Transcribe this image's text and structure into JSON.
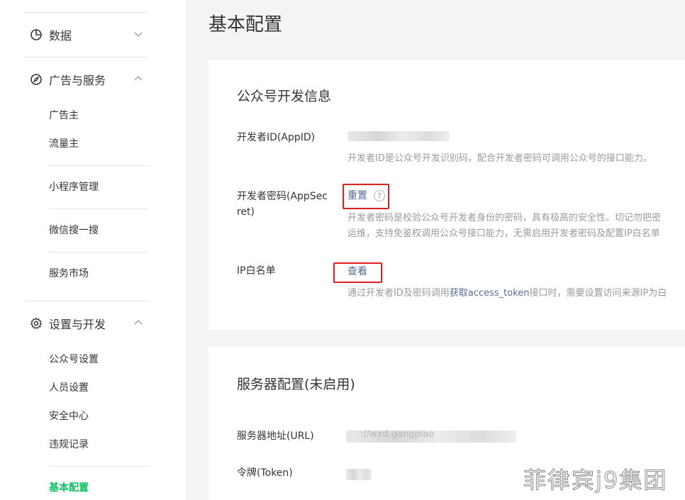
{
  "sidebar": {
    "groups": [
      {
        "label": "数据",
        "icon": "chart-pie-icon",
        "expanded": false
      },
      {
        "label": "广告与服务",
        "icon": "compass-icon",
        "expanded": true,
        "items": [
          "广告主",
          "流量主"
        ]
      },
      {
        "label": "设置与开发",
        "icon": "gear-icon",
        "expanded": true,
        "items": [
          "公众号设置",
          "人员设置",
          "安全中心",
          "违规记录"
        ]
      }
    ],
    "standalone": [
      "小程序管理",
      "微信搜一搜",
      "服务市场"
    ],
    "active_item": "基本配置"
  },
  "page": {
    "title": "基本配置"
  },
  "dev_info": {
    "title": "公众号开发信息",
    "appid_label": "开发者ID(AppID)",
    "appid_desc": "开发者ID是公众号开发识别码，配合开发者密码可调用公众号的接口能力。",
    "secret_label_1": "开发者密码(AppSec",
    "secret_label_2": "ret)",
    "secret_action": "重置",
    "help_glyph": "?",
    "secret_desc_1": "开发者密码是校验公众号开发者身份的密码，具有极高的安全性。切记勿把密",
    "secret_desc_2": "运维，支持免鉴权调用公众号接口能力，无需启用开发者密码及配置IP白名单",
    "ip_label": "IP白名单",
    "ip_action": "查看",
    "ip_desc_pre": "通过开发者ID及密码调用",
    "ip_desc_link": "获取access_token",
    "ip_desc_post": "接口时，需要设置访问来源IP为白"
  },
  "server_config": {
    "title": "服务器配置(未启用)",
    "url_label": "服务器地址(URL)",
    "url_value_partial": "://wxd.gangpiao",
    "token_label": "令牌(Token)"
  },
  "watermark": "菲律宾j9集团"
}
